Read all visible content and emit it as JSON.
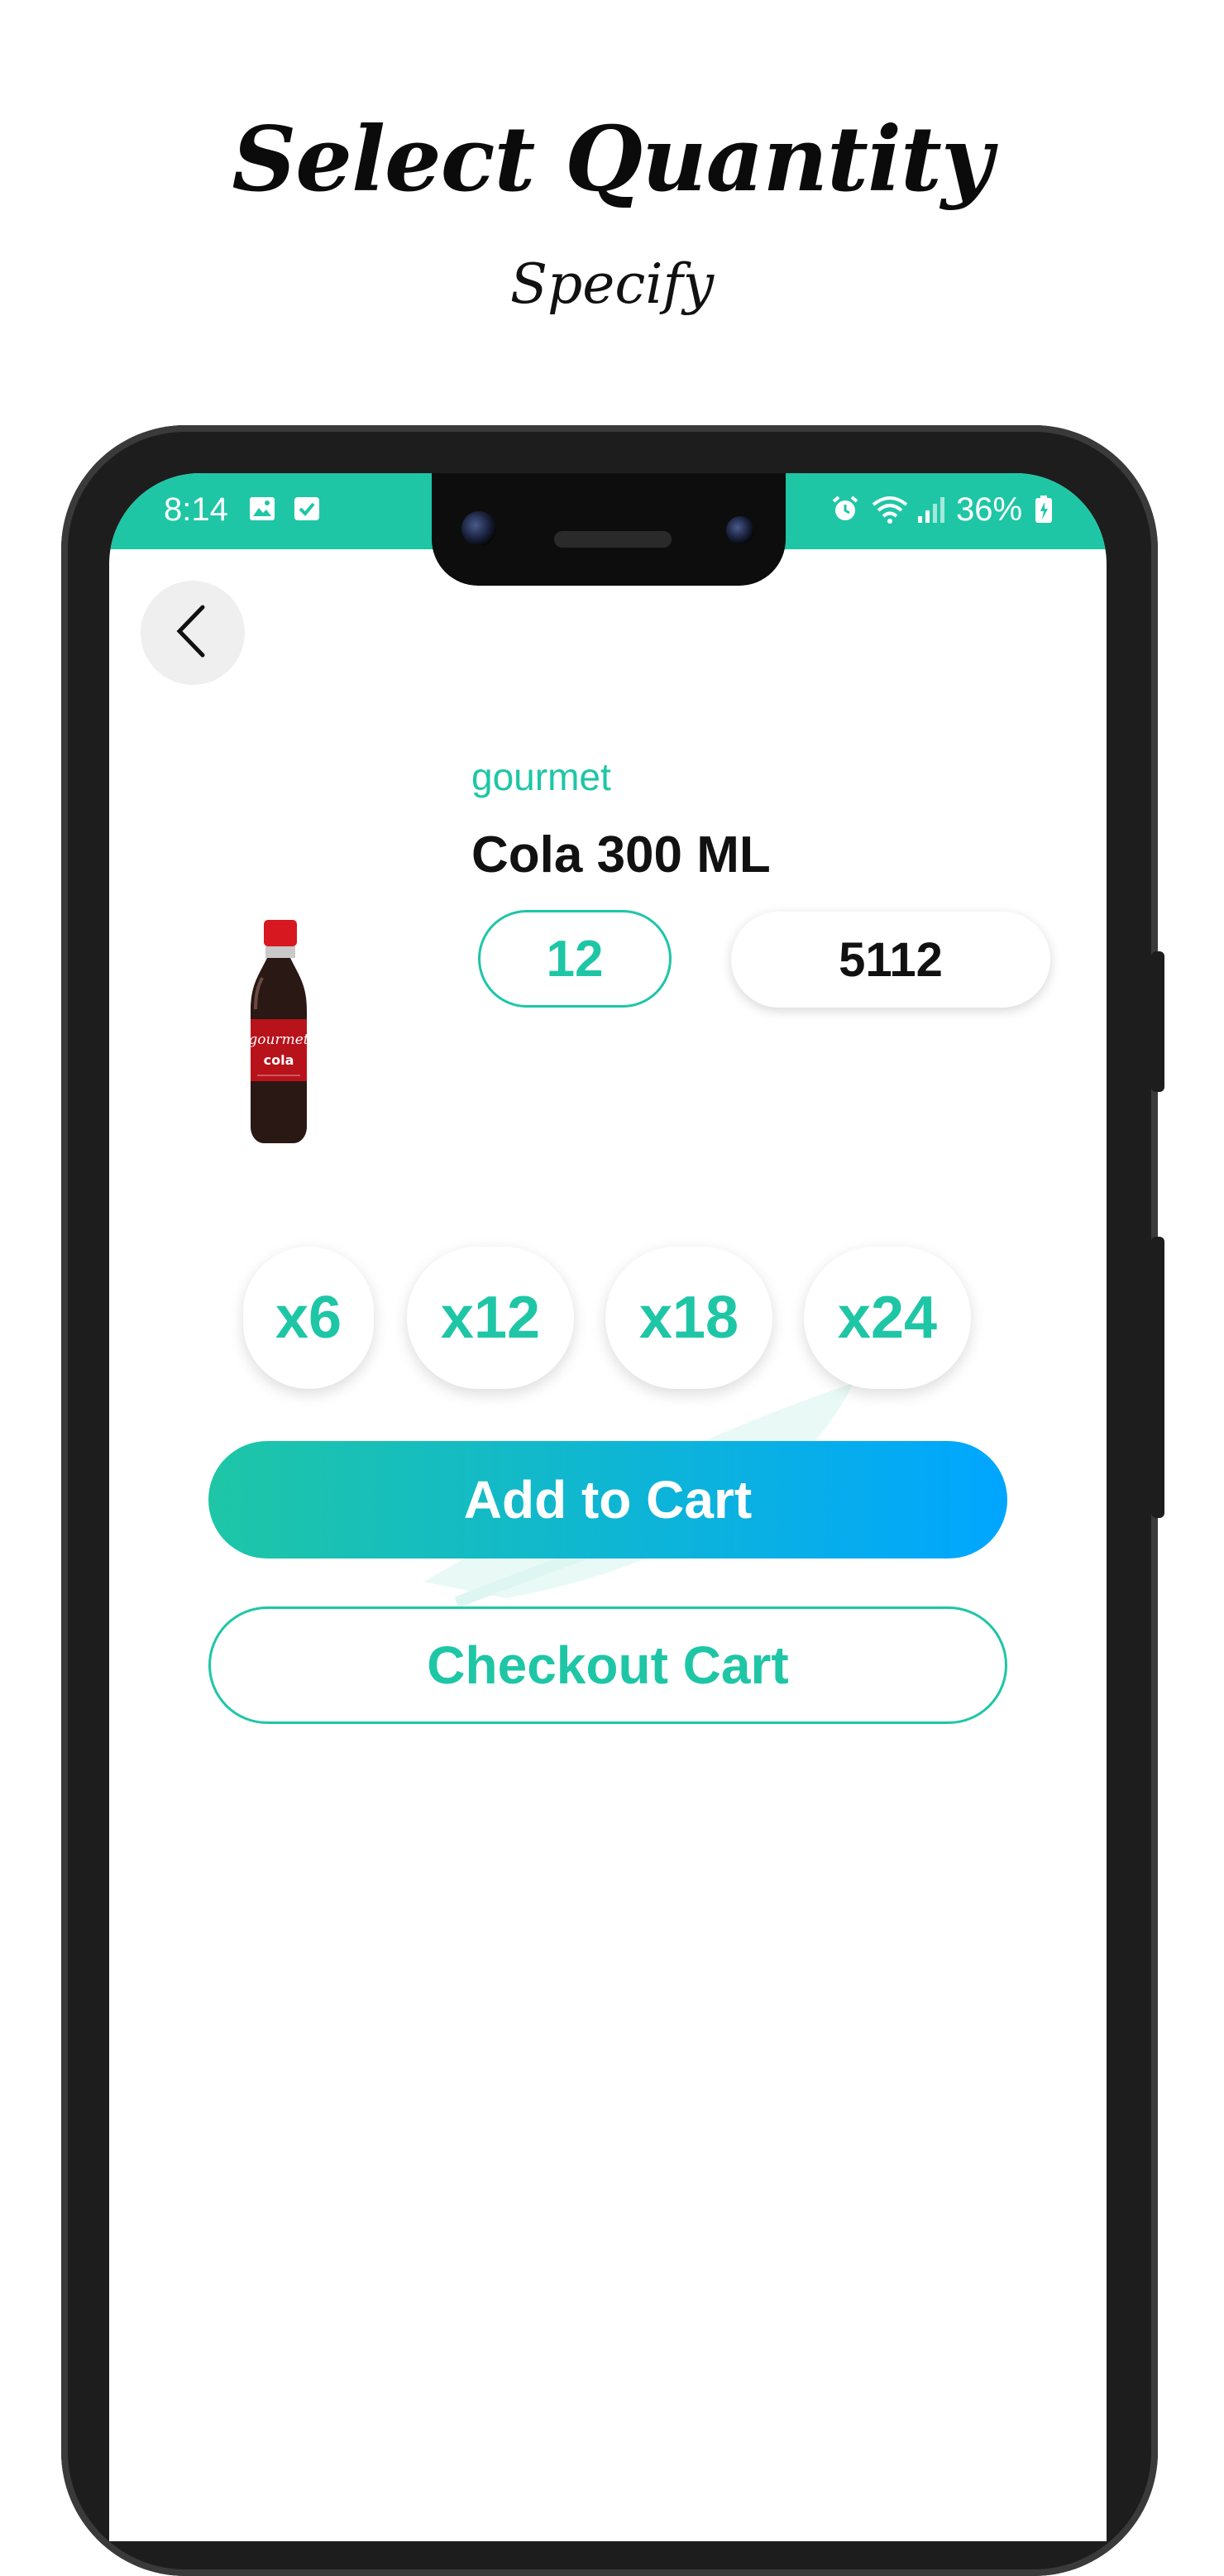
{
  "promo": {
    "title": "Select Quantity",
    "subtitle": "Specify"
  },
  "status_bar": {
    "time": "8:14",
    "battery": "36%",
    "icons": [
      "image-icon",
      "check-box-icon",
      "alarm-icon",
      "wifi-icon",
      "signal-icon",
      "battery-icon"
    ]
  },
  "header": {
    "back_icon": "chevron-left-icon"
  },
  "product": {
    "brand": "gourmet",
    "name": "Cola 300 ML",
    "quantity": "12",
    "code": "5112",
    "image_icon": "cola-bottle"
  },
  "multipliers": [
    "x6",
    "x12",
    "x18",
    "x24"
  ],
  "actions": {
    "add_to_cart": "Add to Cart",
    "checkout": "Checkout Cart"
  },
  "colors": {
    "accent": "#1ec6a6",
    "gradient_end": "#00a6ff",
    "frame": "#1d1d1d"
  }
}
